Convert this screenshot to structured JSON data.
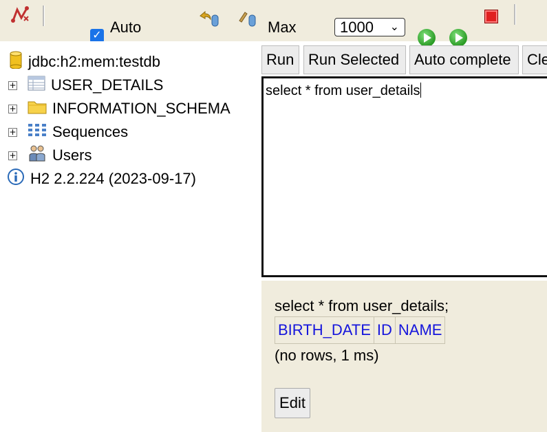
{
  "toolbar": {
    "auto_label": "Auto",
    "auto_checked": true,
    "max_label": "Max",
    "max_value": "1000"
  },
  "tree": {
    "connection": "jdbc:h2:mem:testdb",
    "items": [
      {
        "label": "USER_DETAILS",
        "icon": "table-icon"
      },
      {
        "label": "INFORMATION_SCHEMA",
        "icon": "folder-icon"
      },
      {
        "label": "Sequences",
        "icon": "sequences-icon"
      },
      {
        "label": "Users",
        "icon": "users-icon"
      }
    ],
    "version": "H2 2.2.224 (2023-09-17)"
  },
  "buttons": {
    "run": "Run",
    "run_selected": "Run Selected",
    "auto_complete": "Auto complete",
    "clear": "Cle"
  },
  "editor": {
    "sql": "select * from user_details"
  },
  "results": {
    "query": "select * from user_details;",
    "columns": [
      "BIRTH_DATE",
      "ID",
      "NAME"
    ],
    "info": "(no rows, 1 ms)",
    "edit_label": "Edit"
  },
  "colors": {
    "toolbar_bg": "#f0ecdd",
    "result_bg": "#f0ecdd",
    "link_blue": "#1515dc"
  }
}
